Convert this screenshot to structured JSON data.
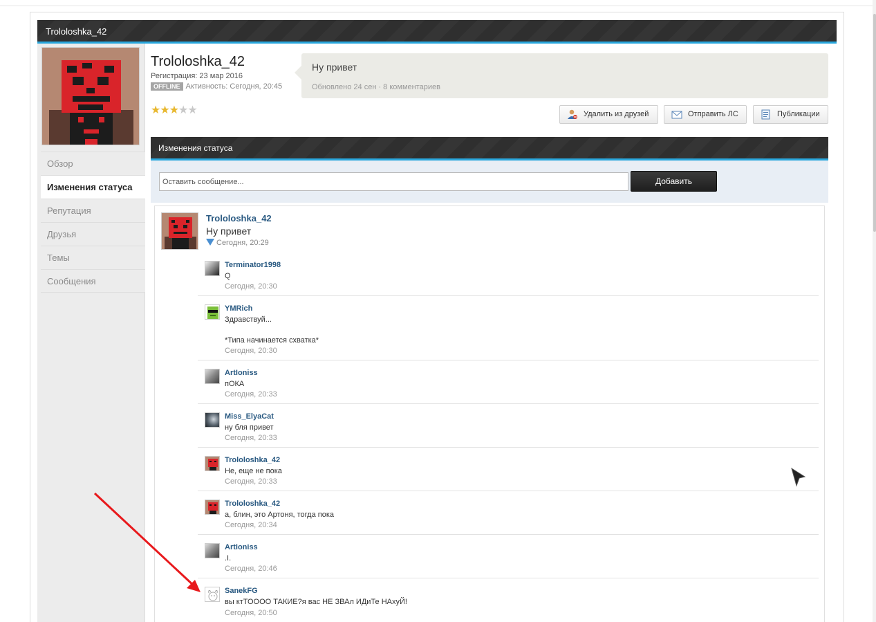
{
  "header": {
    "title": "Trololoshka_42"
  },
  "profile": {
    "username": "Trololoshka_42",
    "registration": "Регистрация: 23 мар 2016",
    "offline_badge": "OFFLINE",
    "activity": "Активность: Сегодня, 20:45",
    "rating": {
      "stars": 3,
      "max": 5
    }
  },
  "sidebar": {
    "items": [
      {
        "label": "Обзор",
        "active": false
      },
      {
        "label": "Изменения статуса",
        "active": true
      },
      {
        "label": "Репутация",
        "active": false
      },
      {
        "label": "Друзья",
        "active": false
      },
      {
        "label": "Темы",
        "active": false
      },
      {
        "label": "Сообщения",
        "active": false
      }
    ]
  },
  "status": {
    "text": "Ну привет",
    "meta": "Обновлено 24 сен · 8 комментариев"
  },
  "actions": {
    "remove_friend": "Удалить из друзей",
    "send_pm": "Отправить ЛС",
    "publications": "Публикации"
  },
  "section": {
    "title": "Изменения статуса"
  },
  "compose": {
    "placeholder": "Оставить сообщение...",
    "add_label": "Добавить"
  },
  "post": {
    "author": "Trololoshka_42",
    "text": "Ну привет",
    "time": "Сегодня, 20:29"
  },
  "comments": [
    {
      "author": "Terminator1998",
      "text": "Q",
      "time": "Сегодня, 20:30"
    },
    {
      "author": "YMRich",
      "text": "Здравствуй...\n\n*Типа начинается схватка*",
      "time": "Сегодня, 20:30"
    },
    {
      "author": "ArtIoniss",
      "text": "пОКА",
      "time": "Сегодня, 20:33"
    },
    {
      "author": "Miss_ElyaCat",
      "text": "ну бля привет",
      "time": "Сегодня, 20:33"
    },
    {
      "author": "Trololoshka_42",
      "text": "Не, еще не пока",
      "time": "Сегодня, 20:33"
    },
    {
      "author": "Trololoshka_42",
      "text": "а, блин, это Артоня, тогда пока",
      "time": "Сегодня, 20:34"
    },
    {
      "author": "ArtIoniss",
      "text": ".I.",
      "time": "Сегодня, 20:46"
    },
    {
      "author": "SanekFG",
      "text": "вы ктТОООО ТАКИЕ?я вас НЕ ЗВАл ИДиТе НАхуЙ!",
      "time": "Сегодня, 20:50"
    }
  ],
  "colors": {
    "accent": "#29a7dd",
    "link": "#2a5a82",
    "annotation_arrow": "#e8191c"
  }
}
